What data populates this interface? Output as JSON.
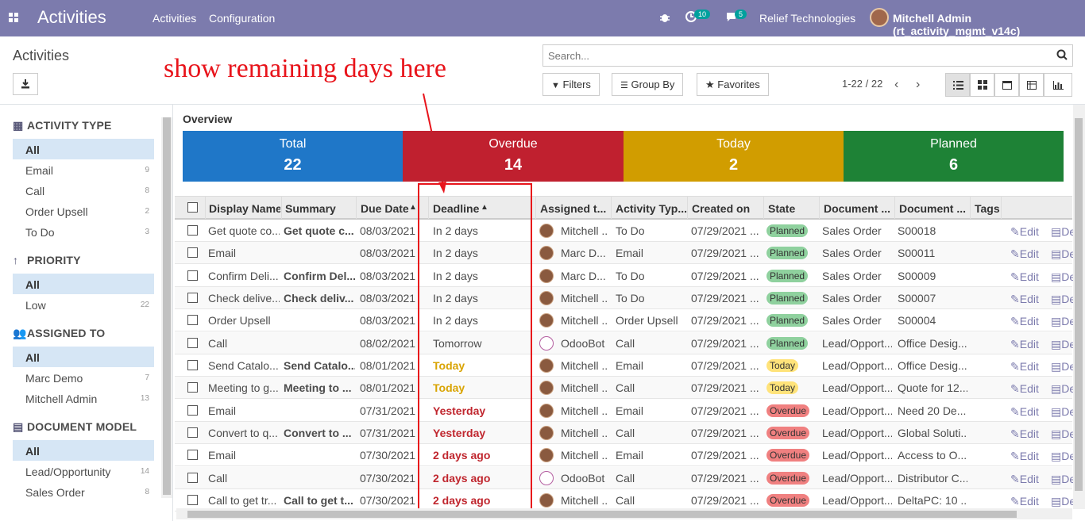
{
  "topbar": {
    "app_name": "Activities",
    "menu": [
      "Activities",
      "Configuration"
    ],
    "activity_badge": "10",
    "message_badge": "5",
    "company": "Relief Technologies",
    "user": "Mitchell Admin (rt_activity_mgmt_v14c)"
  },
  "control_panel": {
    "title": "Activities",
    "annotation": "show remaining days here",
    "search_placeholder": "Search...",
    "filters": "Filters",
    "group_by": "Group By",
    "favorites": "Favorites",
    "pager": "1-22 / 22"
  },
  "sidebar": {
    "sections": [
      {
        "title": "ACTIVITY TYPE",
        "icon": "grid-icon",
        "items": [
          {
            "label": "All",
            "count": ""
          },
          {
            "label": "Email",
            "count": "9"
          },
          {
            "label": "Call",
            "count": "8"
          },
          {
            "label": "Order Upsell",
            "count": "2"
          },
          {
            "label": "To Do",
            "count": "3"
          }
        ]
      },
      {
        "title": "PRIORITY",
        "icon": "arrow-up-icon",
        "items": [
          {
            "label": "All",
            "count": ""
          },
          {
            "label": "Low",
            "count": "22"
          }
        ]
      },
      {
        "title": "ASSIGNED TO",
        "icon": "users-icon",
        "items": [
          {
            "label": "All",
            "count": ""
          },
          {
            "label": "Marc Demo",
            "count": "7"
          },
          {
            "label": "Mitchell Admin",
            "count": "13"
          }
        ]
      },
      {
        "title": "DOCUMENT MODEL",
        "icon": "document-icon",
        "items": [
          {
            "label": "All",
            "count": ""
          },
          {
            "label": "Lead/Opportunity",
            "count": "14"
          },
          {
            "label": "Sales Order",
            "count": "8"
          }
        ]
      }
    ]
  },
  "overview": {
    "title": "Overview",
    "cards": [
      {
        "label": "Total",
        "value": "22",
        "color": "#1f77c8"
      },
      {
        "label": "Overdue",
        "value": "14",
        "color": "#c0202f"
      },
      {
        "label": "Today",
        "value": "2",
        "color": "#d19d00"
      },
      {
        "label": "Planned",
        "value": "6",
        "color": "#1e8236"
      }
    ]
  },
  "table": {
    "headers": [
      "Display Name",
      "Summary",
      "Due Date",
      "Deadline",
      "Assigned t...",
      "Activity Typ...",
      "Created on",
      "State",
      "Document ...",
      "Document ...",
      "Tags"
    ],
    "edit_label": "Edit",
    "delete_cut": "De",
    "rows": [
      {
        "name": "Get quote co...",
        "summary": "Get quote c...",
        "due": "08/03/2021",
        "deadline": "In 2 days",
        "dl": "ok",
        "assigned": "Mitchell ...",
        "bot": false,
        "type": "To Do",
        "created": "07/29/2021 ...",
        "state": "Planned",
        "st": "planned",
        "model": "Sales Order",
        "doc": "S00018"
      },
      {
        "name": "Email",
        "summary": "",
        "due": "08/03/2021",
        "deadline": "In 2 days",
        "dl": "ok",
        "assigned": "Marc D...",
        "bot": false,
        "type": "Email",
        "created": "07/29/2021 ...",
        "state": "Planned",
        "st": "planned",
        "model": "Sales Order",
        "doc": "S00011"
      },
      {
        "name": "Confirm Deli...",
        "summary": "Confirm Del...",
        "due": "08/03/2021",
        "deadline": "In 2 days",
        "dl": "ok",
        "assigned": "Marc D...",
        "bot": false,
        "type": "To Do",
        "created": "07/29/2021 ...",
        "state": "Planned",
        "st": "planned",
        "model": "Sales Order",
        "doc": "S00009"
      },
      {
        "name": "Check delive...",
        "summary": "Check deliv...",
        "due": "08/03/2021",
        "deadline": "In 2 days",
        "dl": "ok",
        "assigned": "Mitchell ...",
        "bot": false,
        "type": "To Do",
        "created": "07/29/2021 ...",
        "state": "Planned",
        "st": "planned",
        "model": "Sales Order",
        "doc": "S00007"
      },
      {
        "name": "Order Upsell",
        "summary": "",
        "due": "08/03/2021",
        "deadline": "In 2 days",
        "dl": "ok",
        "assigned": "Mitchell ...",
        "bot": false,
        "type": "Order Upsell",
        "created": "07/29/2021 ...",
        "state": "Planned",
        "st": "planned",
        "model": "Sales Order",
        "doc": "S00004"
      },
      {
        "name": "Call",
        "summary": "",
        "due": "08/02/2021",
        "deadline": "Tomorrow",
        "dl": "ok",
        "assigned": "OdooBot",
        "bot": true,
        "type": "Call",
        "created": "07/29/2021 ...",
        "state": "Planned",
        "st": "planned",
        "model": "Lead/Opport...",
        "doc": "Office Desig..."
      },
      {
        "name": "Send Catalo...",
        "summary": "Send Catalo...",
        "due": "08/01/2021",
        "deadline": "Today",
        "dl": "today",
        "assigned": "Mitchell ...",
        "bot": false,
        "type": "Email",
        "created": "07/29/2021 ...",
        "state": "Today",
        "st": "today",
        "model": "Lead/Opport...",
        "doc": "Office Desig..."
      },
      {
        "name": "Meeting to g...",
        "summary": "Meeting to ...",
        "due": "08/01/2021",
        "deadline": "Today",
        "dl": "today",
        "assigned": "Mitchell ...",
        "bot": false,
        "type": "Call",
        "created": "07/29/2021 ...",
        "state": "Today",
        "st": "today",
        "model": "Lead/Opport...",
        "doc": "Quote for 12..."
      },
      {
        "name": "Email",
        "summary": "",
        "due": "07/31/2021",
        "deadline": "Yesterday",
        "dl": "over",
        "assigned": "Mitchell ...",
        "bot": false,
        "type": "Email",
        "created": "07/29/2021 ...",
        "state": "Overdue",
        "st": "overdue",
        "model": "Lead/Opport...",
        "doc": "Need 20 De..."
      },
      {
        "name": "Convert to q...",
        "summary": "Convert to ...",
        "due": "07/31/2021",
        "deadline": "Yesterday",
        "dl": "over",
        "assigned": "Mitchell ...",
        "bot": false,
        "type": "Call",
        "created": "07/29/2021 ...",
        "state": "Overdue",
        "st": "overdue",
        "model": "Lead/Opport...",
        "doc": "Global Soluti..."
      },
      {
        "name": "Email",
        "summary": "",
        "due": "07/30/2021",
        "deadline": "2 days ago",
        "dl": "over",
        "assigned": "Mitchell ...",
        "bot": false,
        "type": "Email",
        "created": "07/29/2021 ...",
        "state": "Overdue",
        "st": "overdue",
        "model": "Lead/Opport...",
        "doc": "Access to O..."
      },
      {
        "name": "Call",
        "summary": "",
        "due": "07/30/2021",
        "deadline": "2 days ago",
        "dl": "over",
        "assigned": "OdooBot",
        "bot": true,
        "type": "Call",
        "created": "07/29/2021 ...",
        "state": "Overdue",
        "st": "overdue",
        "model": "Lead/Opport...",
        "doc": "Distributor C..."
      },
      {
        "name": "Call to get tr...",
        "summary": "Call to get t...",
        "due": "07/30/2021",
        "deadline": "2 days ago",
        "dl": "over",
        "assigned": "Mitchell ...",
        "bot": false,
        "type": "Call",
        "created": "07/29/2021 ...",
        "state": "Overdue",
        "st": "overdue",
        "model": "Lead/Opport...",
        "doc": "DeltaPC: 10 ..."
      }
    ]
  }
}
